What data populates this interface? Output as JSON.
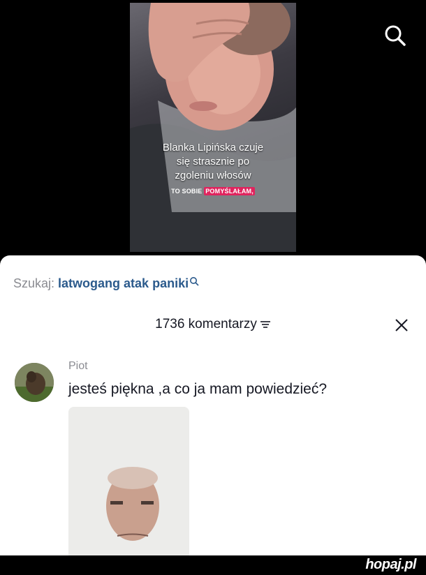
{
  "video": {
    "caption_lines": [
      "Blanka Lipińska czuje",
      "się strasznie po",
      "zgoleniu włosów"
    ],
    "caption2_prefix": "TO SOBIE",
    "caption2_highlight": "POMYŚLAŁAM,"
  },
  "search": {
    "label": "Szukaj:",
    "query": "latwogang atak paniki"
  },
  "comments": {
    "count_text": "1736 komentarzy",
    "items": [
      {
        "author": "Piot",
        "text": "jesteś piękna ,a co ja mam powiedzieć?"
      }
    ]
  },
  "footer": {
    "brand": "hopaj.pl"
  },
  "colors": {
    "accent": "#2b5a8c",
    "highlight": "#e0245e"
  }
}
